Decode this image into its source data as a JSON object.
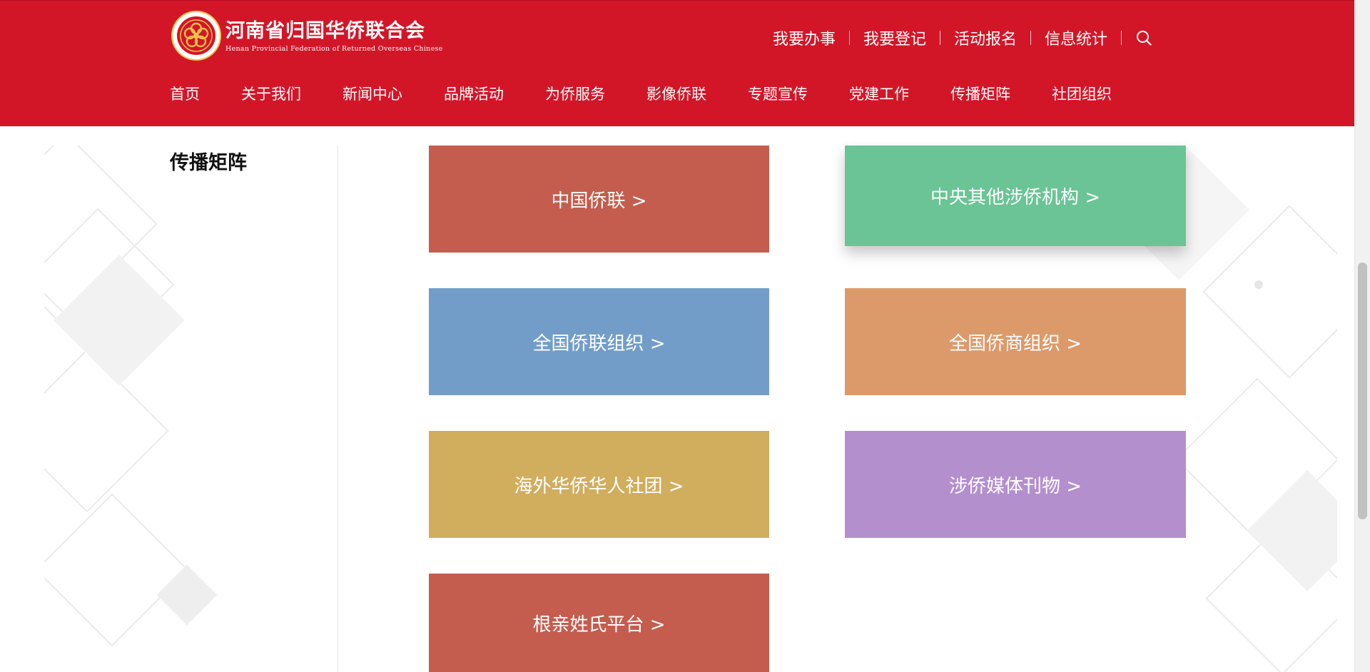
{
  "header": {
    "org_name_cn": "河南省归国华侨联合会",
    "org_name_en": "Henan Provincial Federation of Returned Overseas Chinese",
    "bg_color": "#d21628",
    "quick_links": [
      "我要办事",
      "我要登记",
      "活动报名",
      "信息统计"
    ],
    "search_icon": "search-icon"
  },
  "nav": {
    "items": [
      "首页",
      "关于我们",
      "新闻中心",
      "品牌活动",
      "为侨服务",
      "影像侨联",
      "专题宣传",
      "党建工作",
      "传播矩阵",
      "社团组织"
    ]
  },
  "sidebar": {
    "title": "传播矩阵"
  },
  "tiles": [
    {
      "label": "中国侨联 >",
      "color": "#c45d4e"
    },
    {
      "label": "中央其他涉侨机构 >",
      "color": "#6bc496"
    },
    {
      "label": "全国侨联组织 >",
      "color": "#729dc8"
    },
    {
      "label": "全国侨商组织 >",
      "color": "#dc9a6b"
    },
    {
      "label": "海外华侨华人社团 >",
      "color": "#d1ad5e"
    },
    {
      "label": "涉侨媒体刊物 >",
      "color": "#b48fcd"
    },
    {
      "label": "根亲姓氏平台 >",
      "color": "#c45d4e"
    }
  ]
}
